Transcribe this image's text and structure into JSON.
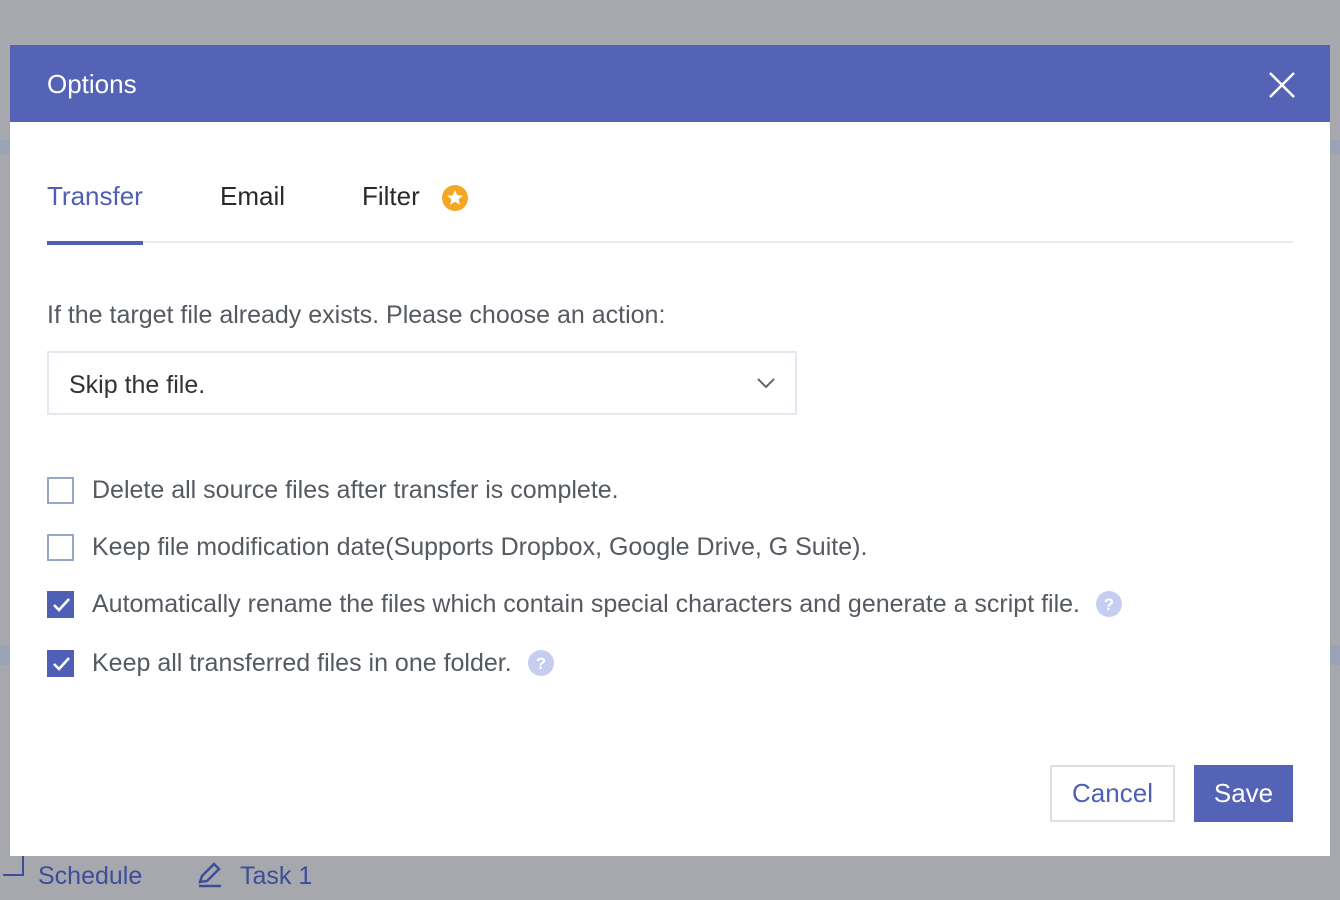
{
  "dialog": {
    "title": "Options",
    "close_icon": "close-icon"
  },
  "tabs": [
    {
      "label": "Transfer",
      "active": true
    },
    {
      "label": "Email",
      "active": false
    },
    {
      "label": "Filter",
      "active": false,
      "badge_icon": "premium-star-icon"
    }
  ],
  "transfer": {
    "prompt": "If the target file already exists. Please choose an action:",
    "action_select": {
      "value": "Skip the file."
    },
    "options": [
      {
        "label": "Delete all source files after transfer is complete.",
        "checked": false,
        "help": false
      },
      {
        "label": "Keep file modification date(Supports Dropbox, Google Drive, G Suite).",
        "checked": false,
        "help": false
      },
      {
        "label": "Automatically rename the files which contain special characters and generate a script file.",
        "checked": true,
        "help": true
      },
      {
        "label": "Keep all transferred files in one folder.",
        "checked": true,
        "help": true
      }
    ]
  },
  "footer": {
    "cancel_label": "Cancel",
    "save_label": "Save"
  },
  "background": {
    "schedule_label": "Schedule",
    "task_label": "Task 1"
  },
  "colors": {
    "accent": "#5463b5",
    "premium": "#f5a623",
    "help": "#c5cdf0"
  }
}
